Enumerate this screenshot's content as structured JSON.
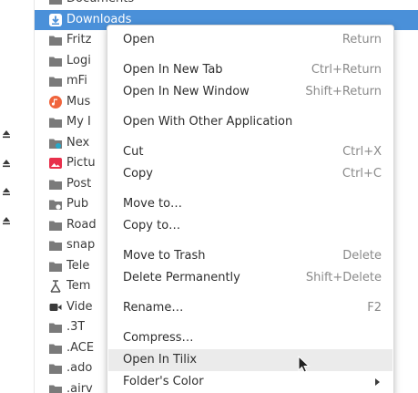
{
  "files": [
    {
      "name": "Documents",
      "icon": "folder-icon",
      "selected": false
    },
    {
      "name": "Downloads",
      "icon": "download-folder-icon",
      "selected": true
    },
    {
      "name": "Fritz",
      "icon": "folder-icon",
      "selected": false
    },
    {
      "name": "Logi",
      "icon": "folder-icon",
      "selected": false
    },
    {
      "name": "mFi",
      "icon": "folder-icon",
      "selected": false
    },
    {
      "name": "Mus",
      "icon": "music-folder-icon",
      "selected": false
    },
    {
      "name": "My I",
      "icon": "folder-icon",
      "selected": false
    },
    {
      "name": "Nex",
      "icon": "shared-folder-icon",
      "selected": false
    },
    {
      "name": "Pictu",
      "icon": "pictures-folder-icon",
      "selected": false
    },
    {
      "name": "Post",
      "icon": "folder-icon",
      "selected": false
    },
    {
      "name": "Pub",
      "icon": "public-folder-icon",
      "selected": false
    },
    {
      "name": "Road",
      "icon": "folder-icon",
      "selected": false
    },
    {
      "name": "snap",
      "icon": "folder-icon",
      "selected": false
    },
    {
      "name": "Tele",
      "icon": "folder-icon",
      "selected": false
    },
    {
      "name": "Tem",
      "icon": "templates-folder-icon",
      "selected": false
    },
    {
      "name": "Vide",
      "icon": "videos-folder-icon",
      "selected": false
    },
    {
      "name": ".3T",
      "icon": "folder-icon",
      "selected": false
    },
    {
      "name": ".ACE",
      "icon": "folder-icon",
      "selected": false
    },
    {
      "name": ".ado",
      "icon": "folder-icon",
      "selected": false
    },
    {
      "name": ".airv",
      "icon": "folder-icon",
      "selected": false
    }
  ],
  "menu": {
    "items": [
      {
        "label": "Open",
        "accel": "Return"
      },
      {
        "label": "Open In New Tab",
        "accel": "Ctrl+Return"
      },
      {
        "label": "Open In New Window",
        "accel": "Shift+Return"
      },
      {
        "label": "Open With Other Application",
        "accel": ""
      },
      {
        "label": "Cut",
        "accel": "Ctrl+X"
      },
      {
        "label": "Copy",
        "accel": "Ctrl+C"
      },
      {
        "label": "Move to…",
        "accel": ""
      },
      {
        "label": "Copy to…",
        "accel": ""
      },
      {
        "label": "Move to Trash",
        "accel": "Delete"
      },
      {
        "label": "Delete Permanently",
        "accel": "Shift+Delete"
      },
      {
        "label": "Rename…",
        "accel": "F2"
      },
      {
        "label": "Compress…",
        "accel": ""
      },
      {
        "label": "Open In Tilix",
        "accel": ""
      },
      {
        "label": "Folder's Color",
        "accel": ""
      }
    ]
  },
  "colors": {
    "selection": "#4a90d9",
    "folder": "#7a7a7a",
    "music": "#f0643c",
    "pictures": "#e8304c",
    "menu_hover": "#ebebeb"
  }
}
